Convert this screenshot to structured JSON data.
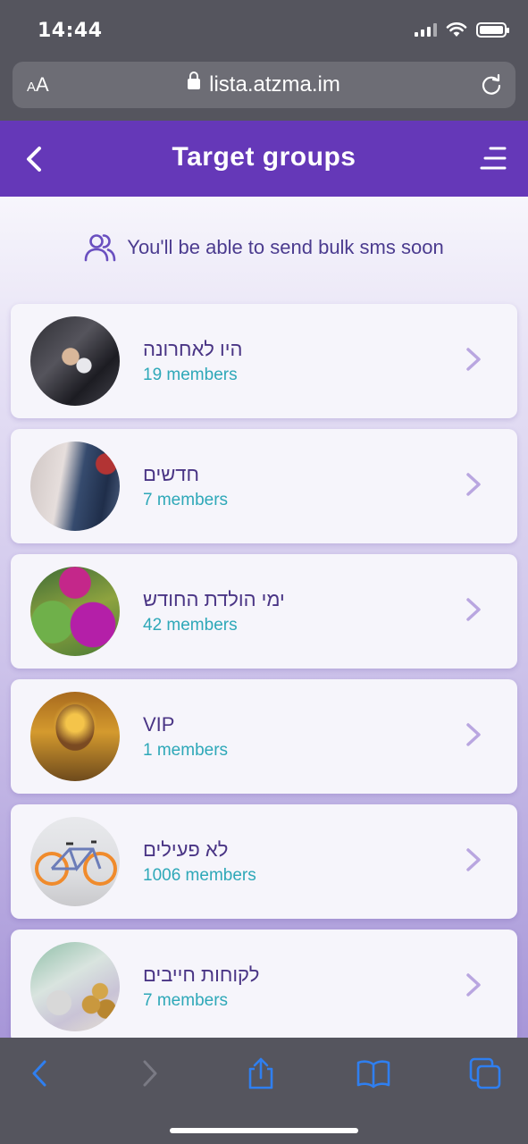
{
  "status_bar": {
    "time": "14:44"
  },
  "browser": {
    "aa_label": "AA",
    "url": "lista.atzma.im"
  },
  "header": {
    "title": "Target groups"
  },
  "notice": {
    "text": "You'll be able to send bulk sms soon"
  },
  "groups": [
    {
      "name": "היו לאחרונה",
      "count": "19 members",
      "image": "handshake"
    },
    {
      "name": "חדשים",
      "count": "7 members",
      "image": "tailor-mannequin"
    },
    {
      "name": "ימי הולדת החודש",
      "count": "42 members",
      "image": "balloons"
    },
    {
      "name": "VIP",
      "count": "1 members",
      "image": "heart-hands"
    },
    {
      "name": "לא פעילים",
      "count": "1006 members",
      "image": "bicycle"
    },
    {
      "name": "לקוחות חייבים",
      "count": "7 members",
      "image": "coins-money"
    }
  ],
  "colors": {
    "header_bg": "#6538b8",
    "accent_teal": "#2ea8b8",
    "text_purple": "#4a3585",
    "safari_bar": "#55555e",
    "ios_blue": "#2f7ff0"
  }
}
